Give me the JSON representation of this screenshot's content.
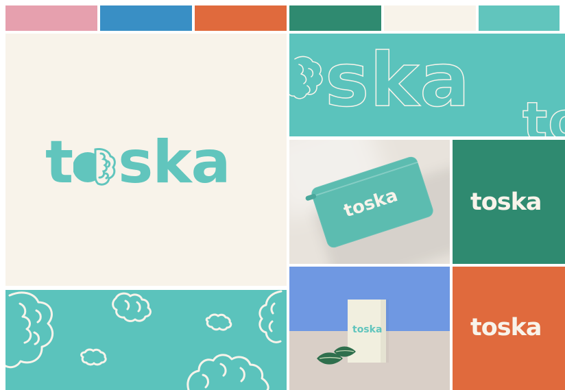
{
  "palette": {
    "colors": [
      "#e6a0ae",
      "#398fc5",
      "#e06a3d",
      "#2f8a70",
      "#f8f3ea",
      "#61c5bd"
    ],
    "bg": "#ffffff"
  },
  "brand": {
    "name": "toska",
    "left": "t",
    "middle_left": "o",
    "right": "ska"
  },
  "main_logo": {
    "color": "#61c5bd",
    "background": "#f8f3ea"
  },
  "banner": {
    "background": "#5bc3bc",
    "outline_text": "ska",
    "outline_text_small": "to"
  },
  "pouch": {
    "background": "#e8e3dc",
    "pouch_color": "#5cbcb0",
    "logo_color": "#f8f3ea",
    "text": "toska"
  },
  "box": {
    "background_top": "#6f98e2",
    "background_bottom": "#d9cfc7",
    "box_color": "#f1efdf",
    "logo_color": "#61c5bd",
    "text": "toska"
  },
  "green_card": {
    "background": "#2f8a70",
    "logo_color": "#f8f3ea",
    "text": "toska"
  },
  "orange_card": {
    "background": "#e06a3d",
    "logo_color": "#f8f3ea",
    "text": "toska"
  },
  "icons": {
    "brain": "brain-icon",
    "leaf": "leaf-icon"
  }
}
